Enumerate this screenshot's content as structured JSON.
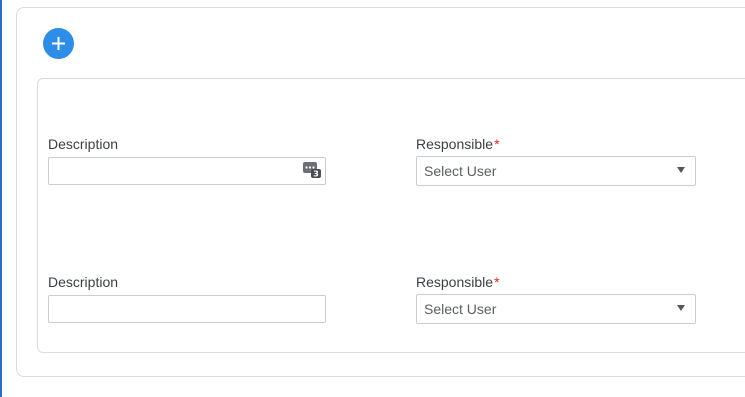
{
  "toolbar": {
    "add_icon": "plus-icon"
  },
  "rows": [
    {
      "description": {
        "label": "Description",
        "value": "",
        "badge_icon": "input-extension-icon",
        "badge_count": "3"
      },
      "responsible": {
        "label": "Responsible",
        "required_mark": "*",
        "selected": "Select User"
      }
    },
    {
      "description": {
        "label": "Description",
        "value": ""
      },
      "responsible": {
        "label": "Responsible",
        "required_mark": "*",
        "selected": "Select User"
      }
    }
  ],
  "colors": {
    "accent": "#2c8ee8",
    "required": "#e02424",
    "border": "#d9dce1"
  }
}
